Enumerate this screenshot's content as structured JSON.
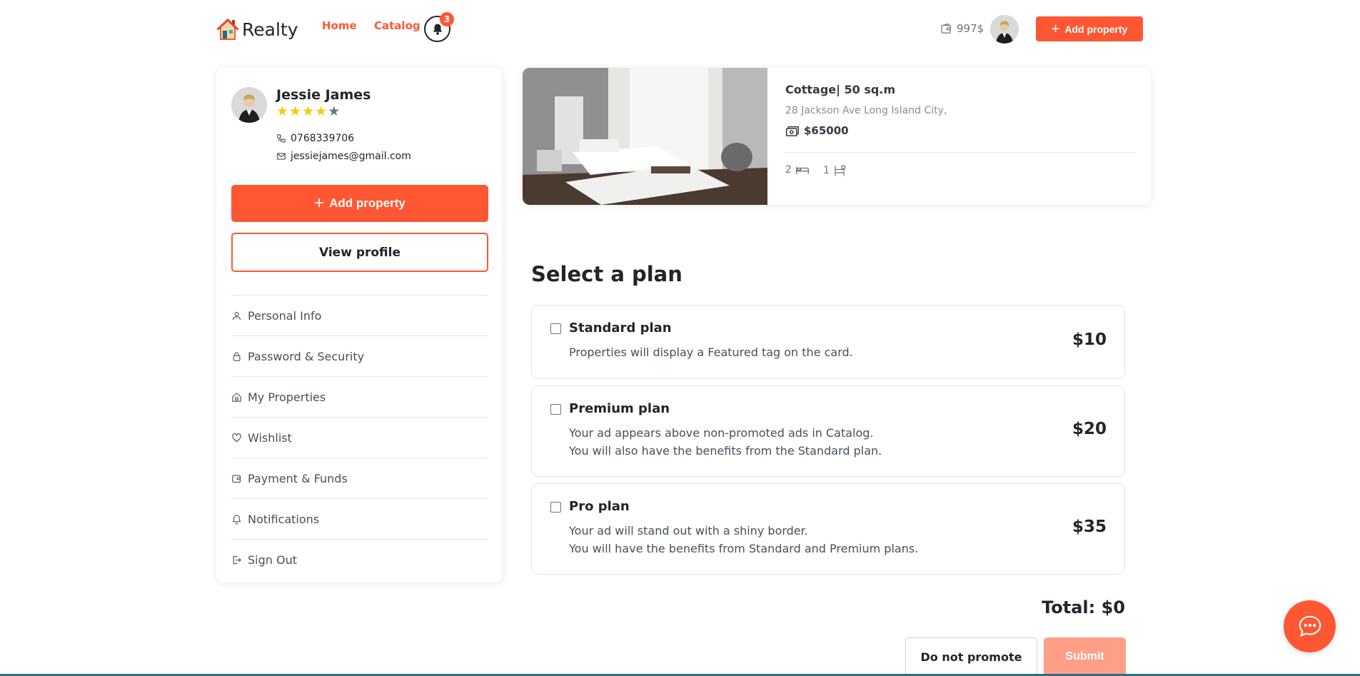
{
  "header": {
    "brand": "Realty",
    "nav": {
      "home": "Home",
      "catalog": "Catalog"
    },
    "notification_count": "3",
    "wallet_amount": "997$",
    "add_property_label": "Add property"
  },
  "profile": {
    "name": "Jessie James",
    "rating": 4,
    "rating_max": 5,
    "phone": "0768339706",
    "email": "jessiejames@gmail.com",
    "add_property_label": "Add property",
    "view_profile_label": "View profile"
  },
  "menu": {
    "items": [
      {
        "label": "Personal Info",
        "icon": "user-icon"
      },
      {
        "label": "Password & Security",
        "icon": "lock-icon"
      },
      {
        "label": "My Properties",
        "icon": "home-icon"
      },
      {
        "label": "Wishlist",
        "icon": "heart-icon"
      },
      {
        "label": "Payment & Funds",
        "icon": "wallet-icon"
      },
      {
        "label": "Notifications",
        "icon": "bell-icon"
      },
      {
        "label": "Sign Out",
        "icon": "sign-out-icon"
      }
    ]
  },
  "property": {
    "title": "Cottage| 50 sq.m",
    "address": "28 Jackson Ave Long Island City,",
    "price": "$65000",
    "bedrooms": "2",
    "bathrooms": "1"
  },
  "plans": {
    "title": "Select a plan",
    "items": [
      {
        "name": "Standard plan",
        "line1": "Properties will display a Featured tag on the card.",
        "line2": "",
        "price": "$10",
        "checked": false
      },
      {
        "name": "Premium plan",
        "line1": "Your ad appears above non-promoted ads in Catalog.",
        "line2": "You will also have the benefits from the Standard plan.",
        "price": "$20",
        "checked": false
      },
      {
        "name": "Pro plan",
        "line1": "Your ad will stand out with a shiny border.",
        "line2": "You will have the benefits from Standard and Premium plans.",
        "price": "$35",
        "checked": false
      }
    ],
    "total_label": "Total: $0",
    "no_promote_label": "Do not promote",
    "submit_label": "Submit"
  },
  "colors": {
    "accent": "#ff5733",
    "accent_disabled": "#ff9f87",
    "star": "#f9c80e"
  }
}
